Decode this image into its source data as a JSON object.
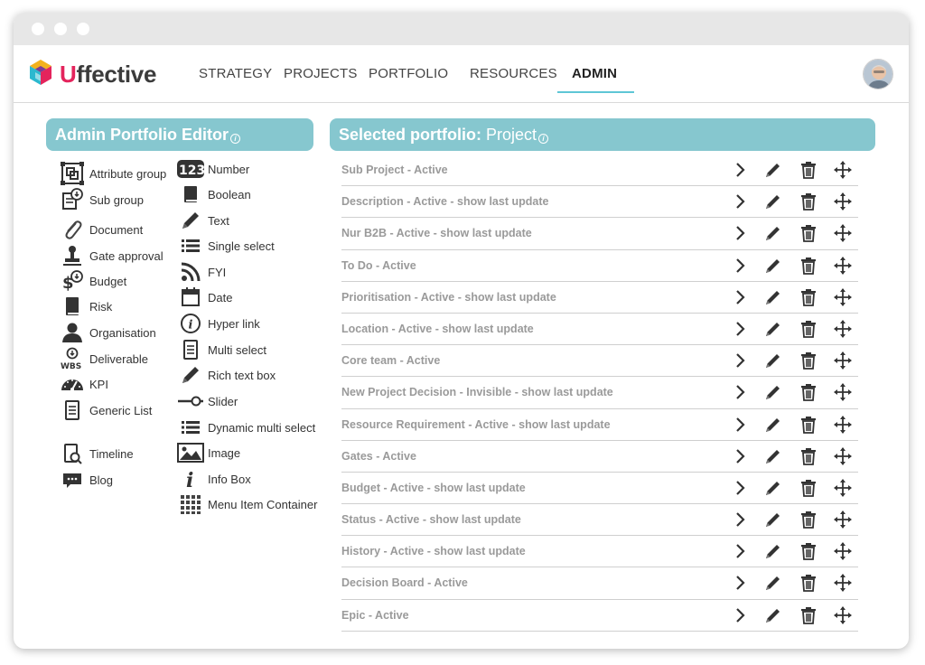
{
  "app": {
    "brand_first": "U",
    "brand_rest": "ffective"
  },
  "nav": {
    "items": [
      {
        "label": "STRATEGY",
        "active": false
      },
      {
        "label": "PROJECTS",
        "active": false
      },
      {
        "label": "PORTFOLIO",
        "active": false
      },
      {
        "label": "RESOURCES",
        "active": false
      },
      {
        "label": "ADMIN",
        "active": true
      }
    ]
  },
  "left_panel": {
    "title": "Admin Portfolio Editor",
    "col1": [
      {
        "label": "Attribute group",
        "icon": "attribute-group-icon"
      },
      {
        "label": "Sub group",
        "icon": "sub-group-icon"
      },
      {
        "label": "Document",
        "icon": "paperclip-icon"
      },
      {
        "label": "Gate approval",
        "icon": "stamp-icon"
      },
      {
        "label": "Budget",
        "icon": "budget-icon"
      },
      {
        "label": "Risk",
        "icon": "risk-book-icon"
      },
      {
        "label": "Organisation",
        "icon": "person-icon"
      },
      {
        "label": "Deliverable",
        "icon": "wbs-icon"
      },
      {
        "label": "KPI",
        "icon": "gauge-icon"
      },
      {
        "label": "Generic List",
        "icon": "list-doc-icon"
      },
      {
        "label": "Timeline",
        "icon": "timeline-icon"
      },
      {
        "label": "Blog",
        "icon": "chat-bubble-icon"
      }
    ],
    "col2": [
      {
        "label": "Number",
        "icon": "number-123-icon"
      },
      {
        "label": "Boolean",
        "icon": "boolean-icon"
      },
      {
        "label": "Text",
        "icon": "pencil-icon"
      },
      {
        "label": "Single select",
        "icon": "list-icon"
      },
      {
        "label": "FYI",
        "icon": "rss-icon"
      },
      {
        "label": "Date",
        "icon": "calendar-icon"
      },
      {
        "label": "Hyper link",
        "icon": "info-circle-icon"
      },
      {
        "label": "Multi select",
        "icon": "list-doc-icon"
      },
      {
        "label": "Rich text box",
        "icon": "pencil-icon"
      },
      {
        "label": "Slider",
        "icon": "slider-icon"
      },
      {
        "label": "Dynamic multi select",
        "icon": "list-icon"
      },
      {
        "label": "Image",
        "icon": "image-icon"
      },
      {
        "label": "Info Box",
        "icon": "info-i-icon"
      },
      {
        "label": "Menu Item Container",
        "icon": "grid-icon"
      }
    ]
  },
  "right_panel": {
    "title_bold": "Selected portfolio:",
    "title_light": " Project",
    "rows": [
      "Sub Project - Active",
      "Description - Active - show last update",
      "Nur B2B - Active - show last update",
      "To Do - Active",
      "Prioritisation - Active - show last update",
      "Location - Active - show last update",
      "Core team - Active",
      "New Project Decision - Invisible - show last update",
      "Resource Requirement - Active - show last update",
      "Gates - Active",
      "Budget - Active - show last update",
      "Status - Active - show last update",
      "History - Active - show last update",
      "Decision Board - Active",
      "Epic - Active"
    ]
  },
  "colors": {
    "accent": "#86c7cf",
    "nav_underline": "#5ec6d6",
    "brand_u": "#e4245c",
    "row_text": "#9a9a9a"
  }
}
